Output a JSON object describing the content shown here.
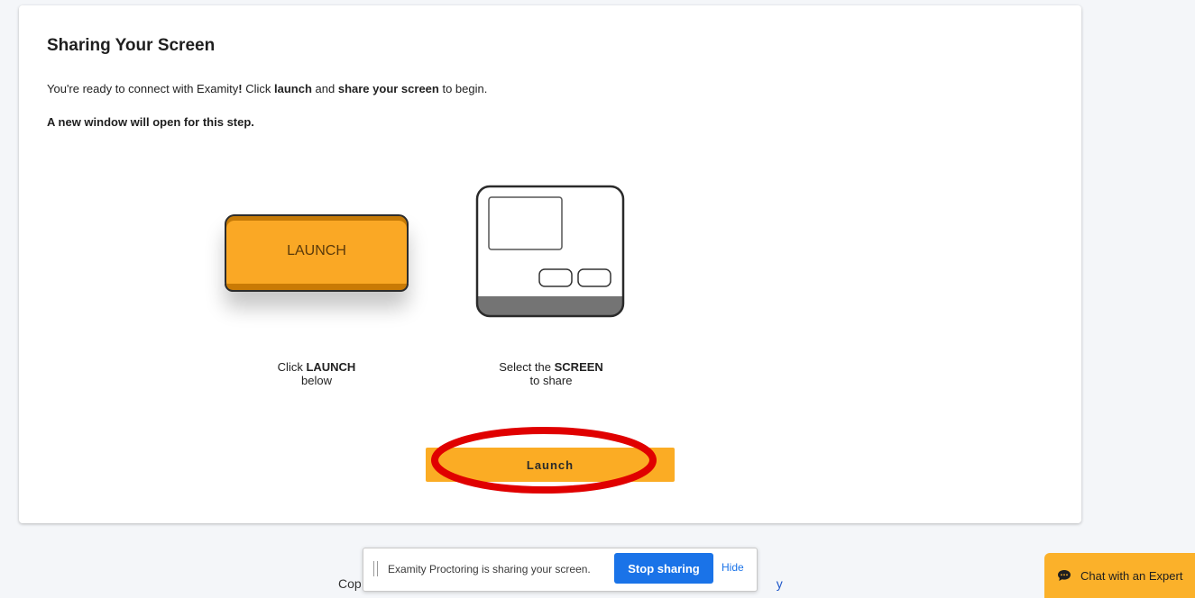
{
  "card": {
    "title": "Sharing Your Screen",
    "intro": {
      "pre": "You're ready to connect with Examity",
      "bang": "!",
      "mid1": " Click ",
      "launch_word": "launch",
      "mid2": " and ",
      "share_words": "share your screen",
      "post": " to begin."
    },
    "note": "A new window will open for this step."
  },
  "illustration": {
    "launch_key_label": "LAUNCH",
    "step1": {
      "pre": "Click ",
      "bold": "LAUNCH",
      "line2": "below"
    },
    "step2": {
      "pre": "Select the ",
      "bold": "SCREEN",
      "line2": "to share"
    }
  },
  "launch_button": {
    "label": "Launch"
  },
  "footer": {
    "visible_start": "Cop",
    "visible_end": "y"
  },
  "share_bar": {
    "message": "Examity Proctoring is sharing your screen.",
    "stop_label": "Stop sharing",
    "hide_label": "Hide"
  },
  "chat": {
    "label": "Chat with an Expert"
  },
  "colors": {
    "accent": "#fbac24",
    "annotation": "#e00000",
    "stop_button": "#1a73e8"
  }
}
